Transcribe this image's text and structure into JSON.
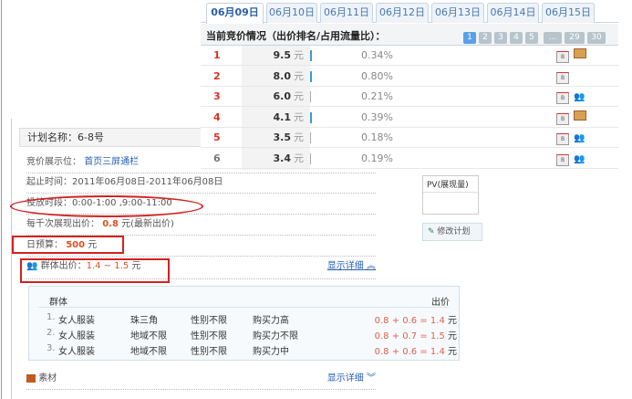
{
  "tabs": [
    "06月09日",
    "06月10日",
    "06月11日",
    "06月12日",
    "06月13日",
    "06月14日",
    "06月15日"
  ],
  "bid_title": "当前竞价情况（出价排名/占用流量比）：",
  "pages": [
    "1",
    "2",
    "3",
    "4",
    "5",
    "...",
    "29",
    "30"
  ],
  "bids": [
    {
      "rank": "1",
      "price": "9.5",
      "unit": "元",
      "share": "0.34%",
      "share_val": 0.34,
      "icons": [
        "bill-icon",
        "banner-icon"
      ]
    },
    {
      "rank": "2",
      "price": "8.0",
      "unit": "元",
      "share": "0.80%",
      "share_val": 0.8,
      "icons": [
        "bill-icon"
      ]
    },
    {
      "rank": "3",
      "price": "6.0",
      "unit": "元",
      "share": "0.21%",
      "share_val": 0.21,
      "icons": [
        "bill-icon",
        "group-icon"
      ]
    },
    {
      "rank": "4",
      "price": "4.1",
      "unit": "元",
      "share": "0.39%",
      "share_val": 0.39,
      "icons": [
        "bill-icon",
        "banner-icon"
      ]
    },
    {
      "rank": "5",
      "price": "3.5",
      "unit": "元",
      "share": "0.18%",
      "share_val": 0.18,
      "icons": [
        "bill-icon",
        "group-icon"
      ]
    },
    {
      "rank": "6",
      "price": "3.4",
      "unit": "元",
      "share": "0.19%",
      "share_val": 0.19,
      "icons": [
        "bill-icon",
        "group-icon"
      ]
    }
  ],
  "plan": {
    "name": "计划名称：6-8号",
    "position_label": "竞价展示位：",
    "position": "首页三屏通栏",
    "period": "起止时间：2011年06月08日-2011年06月08日",
    "timeslot": "投放时段：0:00-1:00 ,9:00-11:00",
    "cpm_label": "每千次展现出价：",
    "cpm": "0.8",
    "cpm_suffix": "元(最新出价)",
    "budget_label": "日预算：",
    "budget": "500",
    "budget_unit": "元",
    "group_label": "群体出价：",
    "group_range": "1.4 ~ 1.5",
    "group_unit": "元",
    "hide_detail": "显示详细",
    "material": "素材",
    "show_detail": "显示详细",
    "pv_label": "PV(展现量)",
    "edit_button": "修改计划"
  },
  "groups": {
    "header_group": "群体",
    "header_price": "出价",
    "rows": [
      {
        "no": "1.",
        "cat": "女人服装",
        "region": "珠三角",
        "gender": "性别不限",
        "power": "购买力高",
        "formula": "0.8 + 0.6 = 1.4",
        "unit": "元"
      },
      {
        "no": "2.",
        "cat": "女人服装",
        "region": "地域不限",
        "gender": "性别不限",
        "power": "购买力不限",
        "formula": "0.8 + 0.7 = 1.5",
        "unit": "元"
      },
      {
        "no": "3.",
        "cat": "女人服装",
        "region": "地域不限",
        "gender": "性别不限",
        "power": "购买力中",
        "formula": "0.8 + 0.6 = 1.4",
        "unit": "元"
      }
    ]
  },
  "colors": {
    "accent": "#2b5ea8",
    "red": "#e03020",
    "bar": "#3a9ad0"
  }
}
